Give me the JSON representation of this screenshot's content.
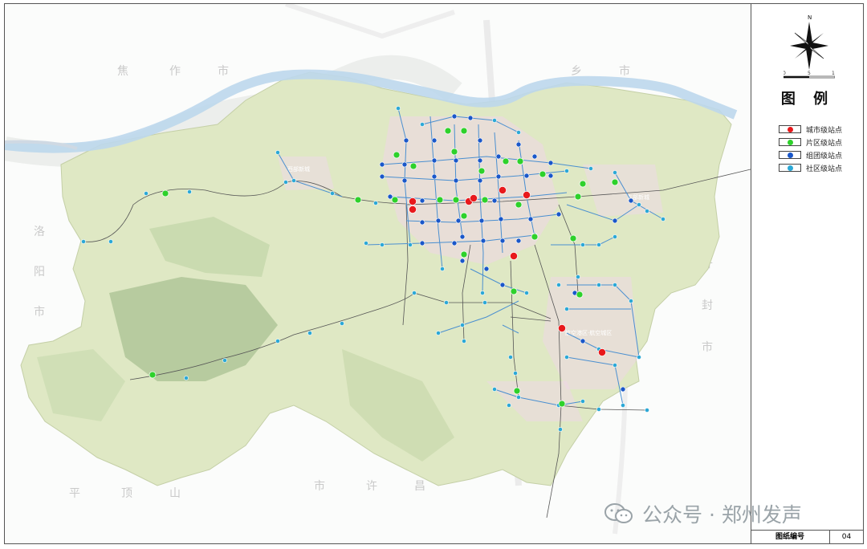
{
  "map": {
    "place_labels": [
      "焦",
      "作",
      "市",
      "乡",
      "市",
      "开",
      "封",
      "市",
      "洛",
      "阳",
      "市",
      "平",
      "顶",
      "山",
      "市",
      "许",
      "昌",
      "市"
    ],
    "area_labels": [
      "西部新城",
      "东部新城",
      "航空港区·航空城区"
    ]
  },
  "north_arrow": {
    "letter": "N",
    "scale_ticks": [
      "0",
      "5",
      "10"
    ],
    "scale_unit": "KM"
  },
  "legend": {
    "title": "图 例",
    "items": [
      {
        "label": "城市级站点",
        "color": "#e8191c"
      },
      {
        "label": "片区级站点",
        "color": "#2ed12b"
      },
      {
        "label": "组团级站点",
        "color": "#1a57c9"
      },
      {
        "label": "社区级站点",
        "color": "#2ba8d6"
      }
    ]
  },
  "title_block": {
    "label": "图纸编号",
    "value": "04"
  },
  "watermark": {
    "text": "公众号 · 郑州发声"
  }
}
